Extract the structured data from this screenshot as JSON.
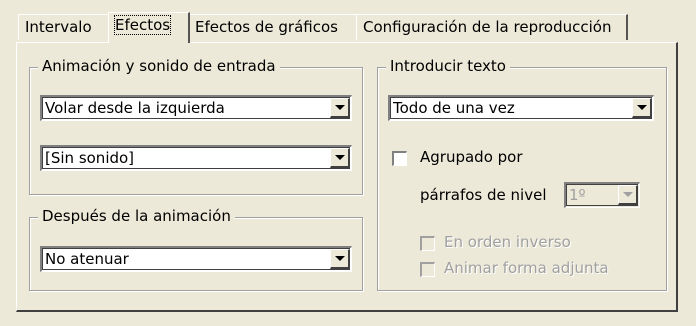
{
  "tabs": [
    {
      "label": "Intervalo",
      "active": false
    },
    {
      "label": "Efectos",
      "active": true
    },
    {
      "label": "Efectos de gráficos",
      "active": false
    },
    {
      "label": "Configuración de la reproducción",
      "active": false
    }
  ],
  "entry_group": {
    "title": "Animación y sonido de entrada",
    "animation_value": "Volar desde la izquierda",
    "sound_value": "[Sin sonido]"
  },
  "after_group": {
    "title": "Después de la animación",
    "after_value": "No atenuar"
  },
  "text_group": {
    "title": "Introducir texto",
    "introduce_value": "Todo de una vez",
    "grouped_label": "Agrupado por",
    "grouped_checked": false,
    "level_label": "párrafos de nivel",
    "level_value": "1º",
    "reverse_label": "En orden inverso",
    "reverse_checked": false,
    "animate_shape_label": "Animar forma adjunta",
    "animate_shape_checked": false
  },
  "colors": {
    "dialog_bg": "#ece9d8",
    "disabled_text": "#a0a0a0"
  }
}
